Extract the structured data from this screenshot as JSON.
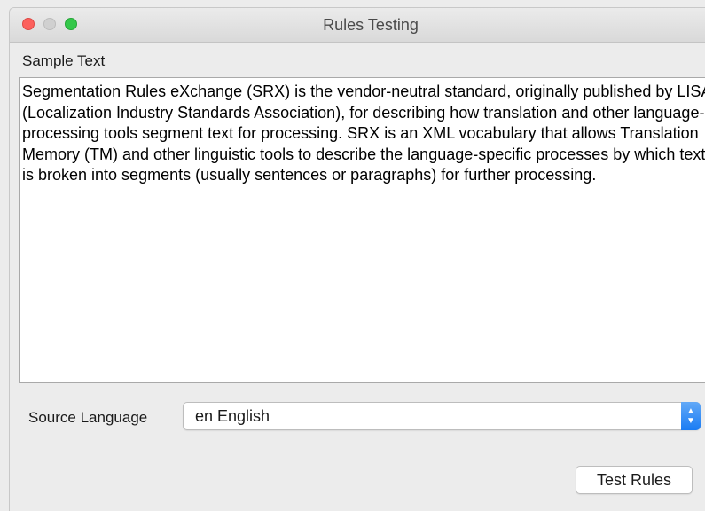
{
  "window": {
    "title": "Rules Testing"
  },
  "sample": {
    "label": "Sample Text",
    "text": "Segmentation Rules eXchange (SRX) is the vendor-neutral standard, originally published by LISA (Localization Industry Standards Association), for describing how translation and other language-processing tools segment text for processing. SRX is an XML vocabulary that allows Translation Memory (TM) and other linguistic tools to describe the language-specific processes by which text is broken into segments (usually sentences or paragraphs) for further processing."
  },
  "source_language": {
    "label": "Source Language",
    "selected": "en English"
  },
  "actions": {
    "test_label": "Test Rules"
  },
  "icons": {
    "close": "close-icon",
    "minimize": "minimize-icon",
    "zoom": "zoom-icon",
    "select_arrows": "up-down-chevron-icon"
  },
  "colors": {
    "close": "#fc605c",
    "minimize": "#d0d0d0",
    "zoom": "#34c84a",
    "accent": "#1a7cf4"
  }
}
